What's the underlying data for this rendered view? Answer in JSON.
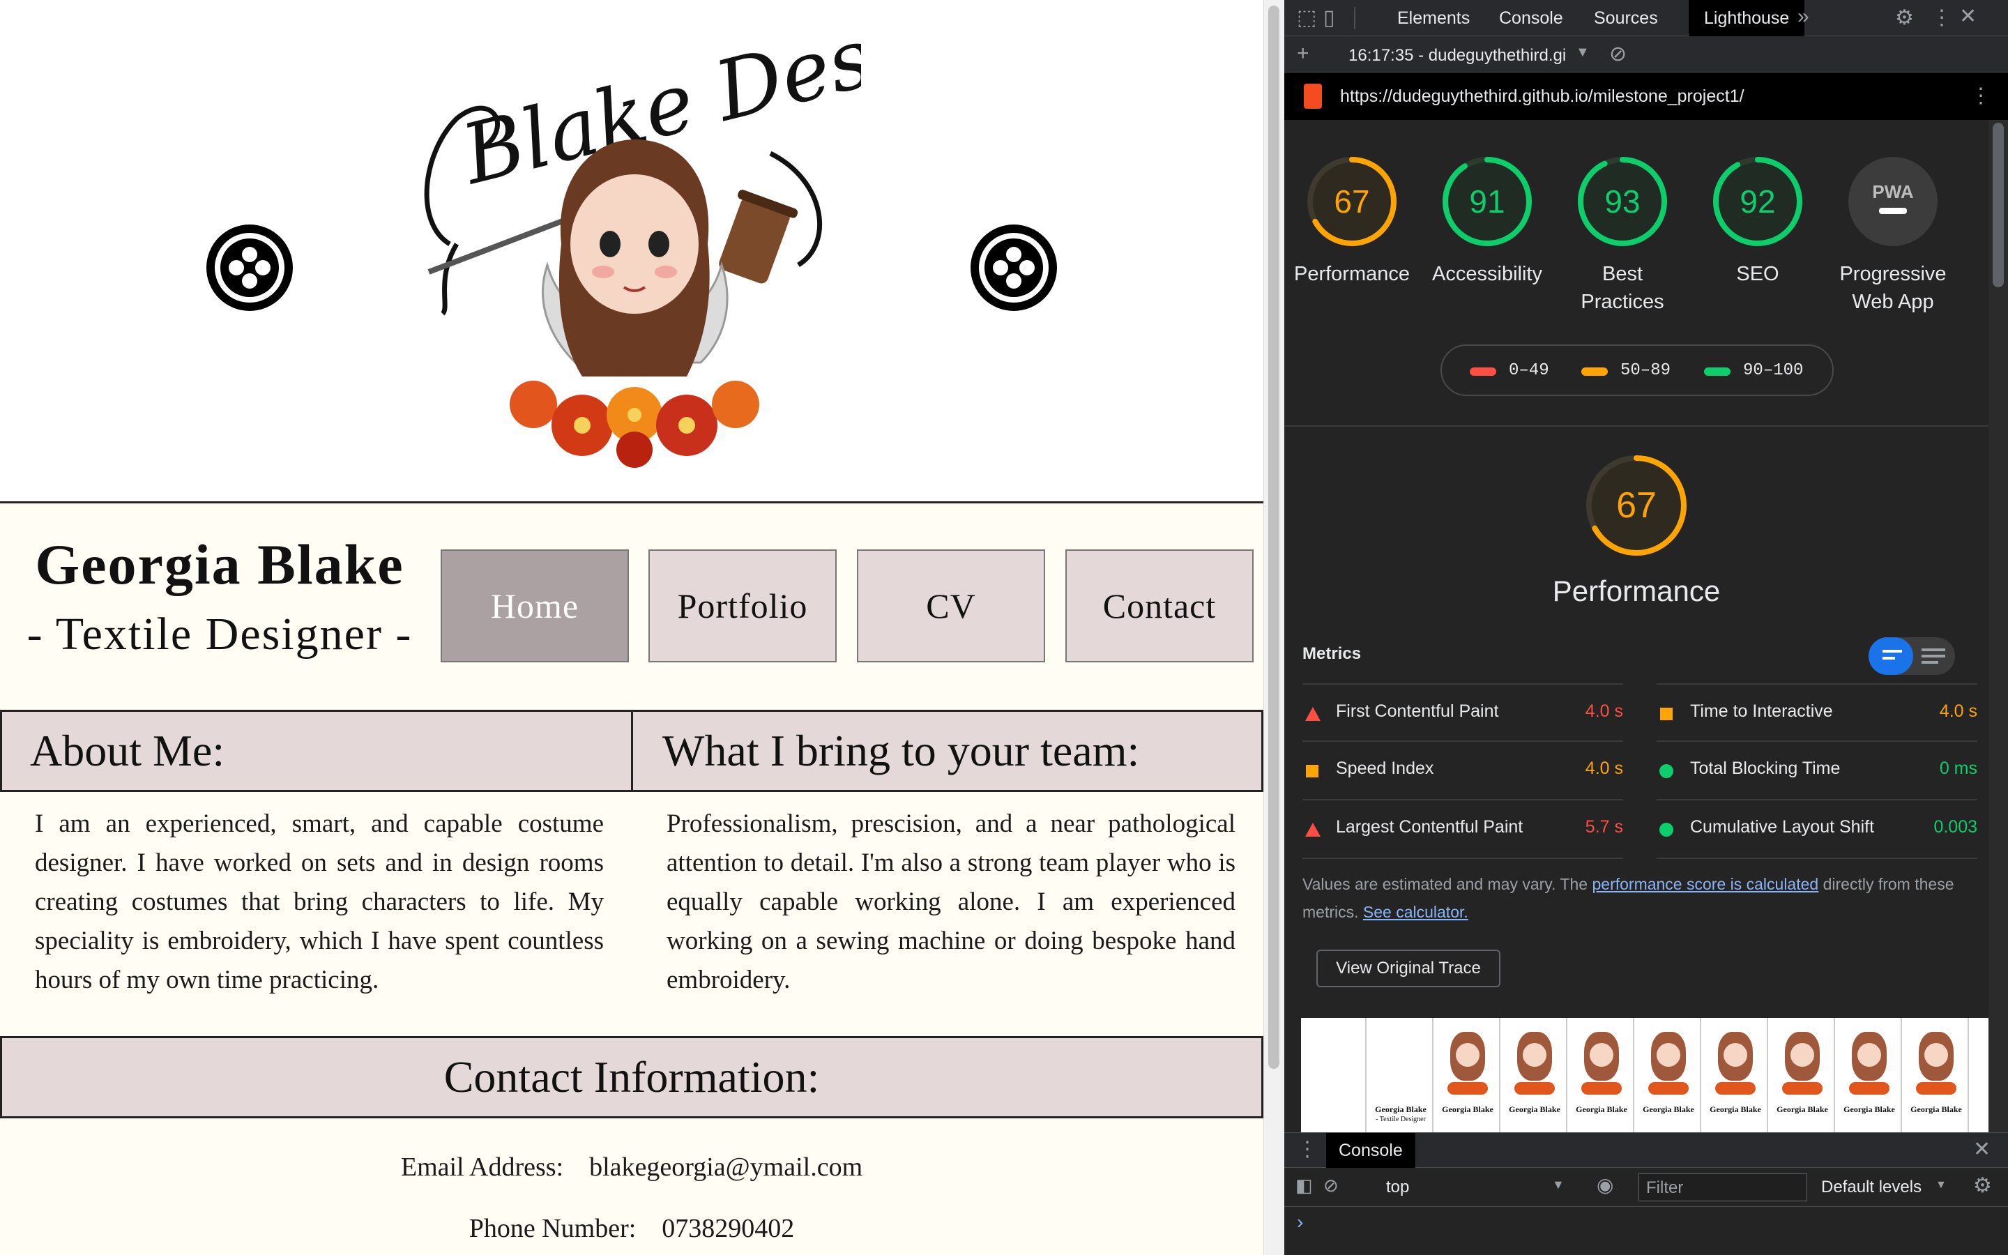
{
  "site": {
    "logo_text": "Blake Designs",
    "name": "Georgia Blake",
    "subtitle": "- Textile Designer -",
    "nav": [
      {
        "label": "Home",
        "active": true
      },
      {
        "label": "Portfolio",
        "active": false
      },
      {
        "label": "CV",
        "active": false
      },
      {
        "label": "Contact",
        "active": false
      }
    ],
    "about": {
      "heading": "About Me:",
      "text": "I am an experienced, smart, and capable costume designer. I have worked on sets and in design rooms creating costumes that bring characters to life. My speciality is embroidery, which I have spent countless hours of my own time practicing."
    },
    "team": {
      "heading": "What I bring to your team:",
      "text": "Professionalism, prescision, and a near pathological attention to detail. I'm also a strong team player who is equally capable working alone. I am experienced working on a sewing machine or doing bespoke hand embroidery."
    },
    "contact": {
      "heading": "Contact Information:",
      "email_label": "Email Address:",
      "email": "blakegeorgia@ymail.com",
      "phone_label": "Phone Number:",
      "phone": "0738290402"
    }
  },
  "devtools": {
    "tabs": [
      "Elements",
      "Console",
      "Sources",
      "Lighthouse"
    ],
    "active_tab": "Lighthouse",
    "more_tabs_icon": "chevron-double-right-icon",
    "report_selector": "16:17:35 - dudeguythethird.gi",
    "url": "https://dudeguythethird.github.io/milestone_project1/",
    "scores": [
      {
        "label": "Performance",
        "score": 67,
        "color": "#ffa400"
      },
      {
        "label": "Accessibility",
        "score": 91,
        "color": "#0cce6b"
      },
      {
        "label": "Best Practices",
        "score": 93,
        "color": "#0cce6b"
      },
      {
        "label": "SEO",
        "score": 92,
        "color": "#0cce6b"
      },
      {
        "label": "Progressive Web App",
        "score": null,
        "color": "#9aa0a6"
      }
    ],
    "pwa_badge": "PWA",
    "legend": [
      {
        "range": "0–49",
        "color": "#ff4e42"
      },
      {
        "range": "50–89",
        "color": "#ffa400"
      },
      {
        "range": "90–100",
        "color": "#0cce6b"
      }
    ],
    "perf_title": "Performance",
    "perf_score": 67,
    "metrics_title": "Metrics",
    "metrics": [
      {
        "name": "First Contentful Paint",
        "value": "4.0 s",
        "status": "fail",
        "color": "#ff4e42"
      },
      {
        "name": "Time to Interactive",
        "value": "4.0 s",
        "status": "average",
        "color": "#ffa400"
      },
      {
        "name": "Speed Index",
        "value": "4.0 s",
        "status": "average",
        "color": "#ffa400"
      },
      {
        "name": "Total Blocking Time",
        "value": "0 ms",
        "status": "pass",
        "color": "#0cce6b"
      },
      {
        "name": "Largest Contentful Paint",
        "value": "5.7 s",
        "status": "fail",
        "color": "#ff4e42"
      },
      {
        "name": "Cumulative Layout Shift",
        "value": "0.003",
        "status": "pass",
        "color": "#0cce6b"
      }
    ],
    "note_pre": "Values are estimated and may vary. The ",
    "note_link1": "performance score is calculated",
    "note_mid": " directly from these metrics. ",
    "note_link2": "See calculator.",
    "trace_button": "View Original Trace",
    "filmstrip_name": "Georgia Blake",
    "filmstrip_sub": "- Textile Designer",
    "drawer_tab": "Console",
    "context": "top",
    "filter_placeholder": "Filter",
    "levels": "Default levels",
    "prompt": "›"
  }
}
